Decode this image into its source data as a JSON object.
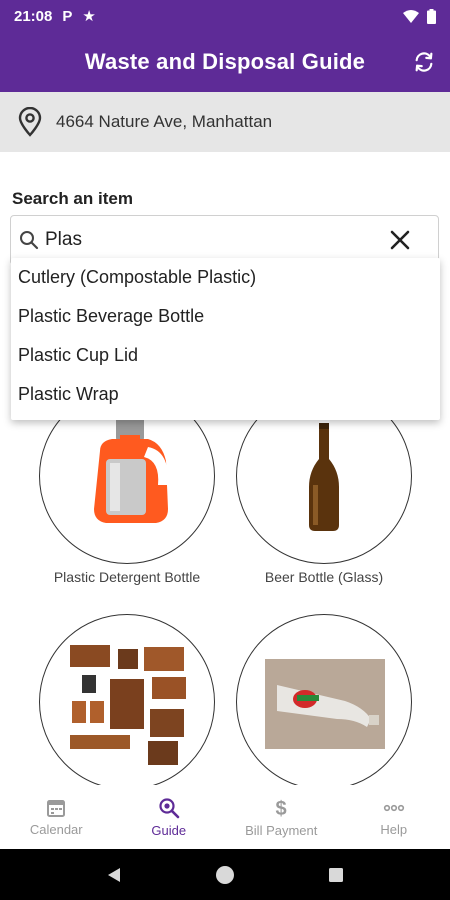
{
  "status_bar": {
    "time": "21:08",
    "p_glyph": "P",
    "star_glyph": "★"
  },
  "header": {
    "title": "Waste and Disposal Guide"
  },
  "address": {
    "text": "4664 Nature Ave, Manhattan"
  },
  "search": {
    "label": "Search an item",
    "value": "Plas",
    "suggestions": [
      "Cutlery (Compostable Plastic)",
      "Plastic Beverage Bottle",
      "Plastic Cup Lid",
      "Plastic Wrap"
    ]
  },
  "items": [
    {
      "caption": "Plastic Detergent Bottle"
    },
    {
      "caption": "Beer Bottle (Glass)"
    },
    {
      "caption": ""
    },
    {
      "caption": ""
    }
  ],
  "bottom_nav": [
    {
      "label": "Calendar",
      "icon": "calendar-icon",
      "active": false
    },
    {
      "label": "Guide",
      "icon": "search-guide-icon",
      "active": true
    },
    {
      "label": "Bill Payment",
      "icon": "dollar-icon",
      "active": false
    },
    {
      "label": "Help",
      "icon": "more-icon",
      "active": false
    }
  ],
  "colors": {
    "primary": "#5e2b97",
    "inactive": "#9a9a9a"
  }
}
